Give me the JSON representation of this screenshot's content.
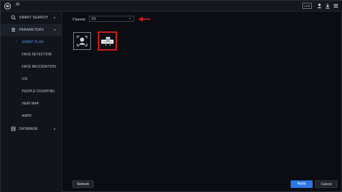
{
  "titlebar": {
    "title": "AI",
    "live_label": "LIVE",
    "icons": [
      "app-logo-icon",
      "user-icon",
      "download-icon",
      "menu-icon"
    ]
  },
  "sidebar": {
    "items": [
      {
        "label": "SMART SEARCH",
        "icon": "search-icon"
      },
      {
        "label": "PARAMETERS",
        "icon": "settings-icon"
      },
      {
        "label": "DATABASE",
        "icon": "database-icon"
      }
    ],
    "subitems": [
      {
        "label": "SMART PLAN",
        "selected": true
      },
      {
        "label": "FACE DETECTION"
      },
      {
        "label": "FACE RECOGNITION"
      },
      {
        "label": "IVS"
      },
      {
        "label": "PEOPLE COUNTING"
      },
      {
        "label": "HEAT MAP"
      },
      {
        "label": "ANPR"
      }
    ]
  },
  "content": {
    "channel_label": "Channel",
    "channel_value": "D1",
    "plan_cards": [
      "face-recognition-plan",
      "anpr-plan"
    ]
  },
  "footer": {
    "refresh_label": "Refresh",
    "apply_label": "Apply",
    "cancel_label": "Cancel"
  },
  "colors": {
    "accent": "#2a78e4",
    "selected_text": "#4d8bf0",
    "highlight_border": "#d21d1d",
    "arrow": "#c81e1e"
  }
}
